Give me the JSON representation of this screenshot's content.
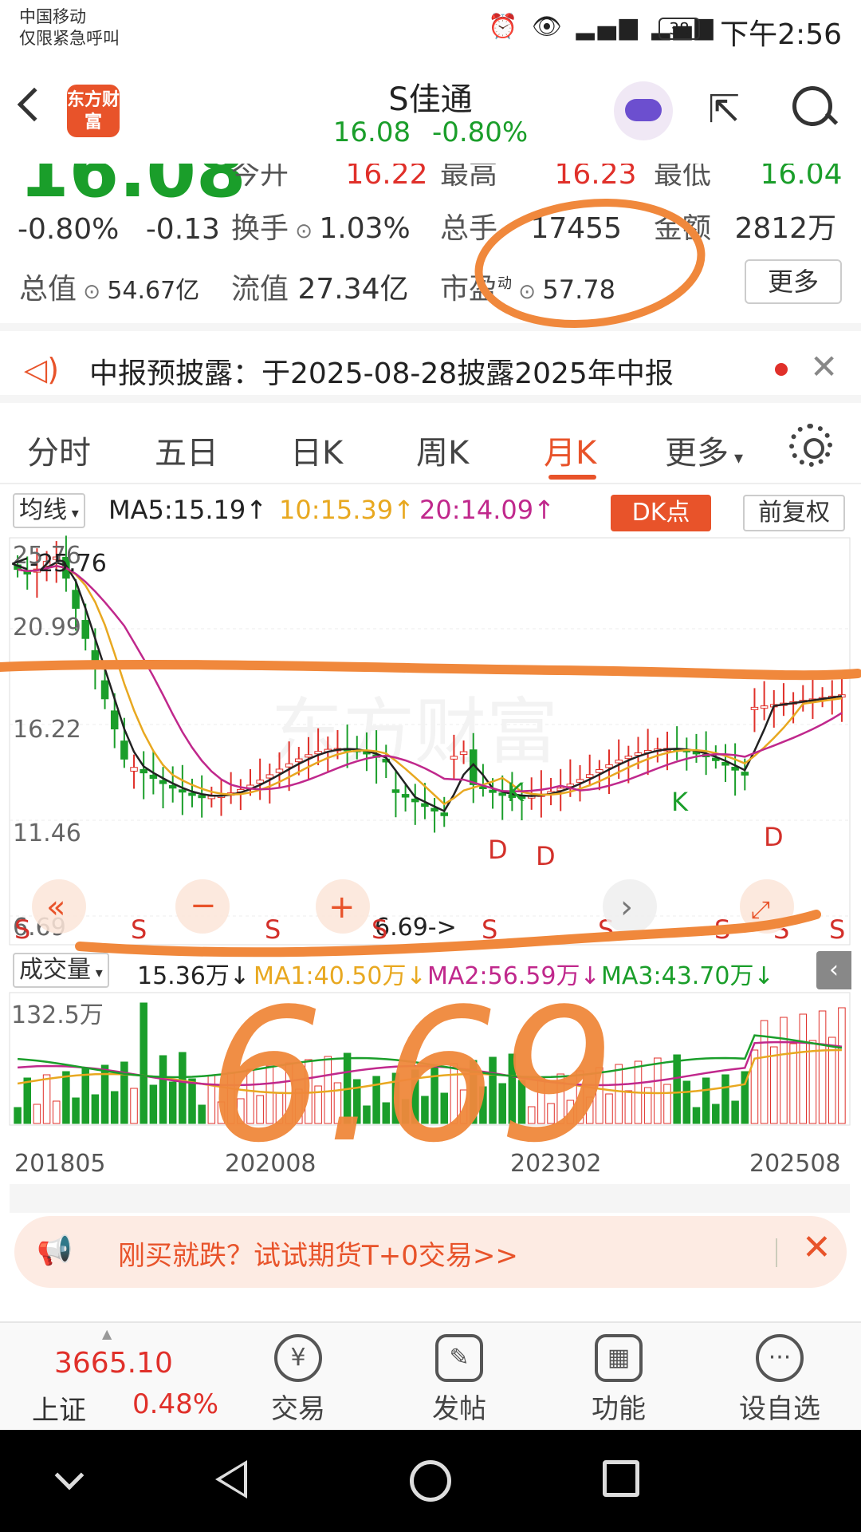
{
  "status_bar": {
    "carrier_line1": "中国移动",
    "carrier_line2": "仅限紧急呼叫",
    "battery": "38",
    "time": "下午2:56"
  },
  "header": {
    "logo_text": "东方财富",
    "stock_name": "S佳通",
    "price": "16.08",
    "change_pct": "-0.80%"
  },
  "quote": {
    "price": "16.08",
    "change_pct": "-0.80%",
    "change_abs": "-0.13",
    "open_label": "今开",
    "open": "16.22",
    "high_label": "最高",
    "high": "16.23",
    "low_label": "最低",
    "low": "16.04",
    "turnover_label": "换手",
    "turnover": "1.03%",
    "volume_label": "总手",
    "volume": "17455",
    "amount_label": "金额",
    "amount": "2812万",
    "total_value_label": "总值",
    "total_value": "54.67亿",
    "float_value_label": "流值",
    "float_value": "27.34亿",
    "pe_label": "市盈",
    "pe_super": "动",
    "pe": "57.78",
    "more": "更多"
  },
  "notice": {
    "text": "中报预披露：于2025-08-28披露2025年中报"
  },
  "tabs": [
    "分时",
    "五日",
    "日K",
    "周K",
    "月K",
    "更多"
  ],
  "active_tab": "月K",
  "ma_bar": {
    "select": "均线",
    "ma5": "MA5:15.19",
    "ma10": "10:15.39",
    "ma20": "20:14.09",
    "dk": "DK点",
    "adjust": "前复权"
  },
  "chart_data": {
    "type": "candlestick",
    "price_axis_labels": [
      "25.76",
      "20.99",
      "16.22",
      "11.46",
      "6.69"
    ],
    "max_marker": "<-25.76",
    "min_marker": "6.69->",
    "x_labels": [
      "201805",
      "202008",
      "202302",
      "202508"
    ],
    "signal_markers": [
      "S",
      "S",
      "S",
      "S",
      "S",
      "S",
      "S",
      "S",
      "S",
      "K",
      "K",
      "D",
      "D",
      "D"
    ],
    "volume_axis_label": "132.5万",
    "ylim": [
      6.69,
      25.76
    ]
  },
  "vol_bar": {
    "select": "成交量",
    "vol": "15.36万",
    "ma1": "MA1:40.50万",
    "ma2": "MA2:56.59万",
    "ma3": "MA3:43.70万"
  },
  "annotation": {
    "handwritten": "6.69"
  },
  "ad": {
    "text": "刚买就跌？试试期货T+0交易>>"
  },
  "bottom": {
    "index_value": "3665.10",
    "index_name": "上证",
    "index_pct": "0.48%",
    "nav": [
      "交易",
      "发帖",
      "功能",
      "设自选"
    ]
  },
  "colors": {
    "up": "#e0302a",
    "down": "#1a9e2a",
    "accent": "#e8532a",
    "annotation": "#f0883c"
  }
}
